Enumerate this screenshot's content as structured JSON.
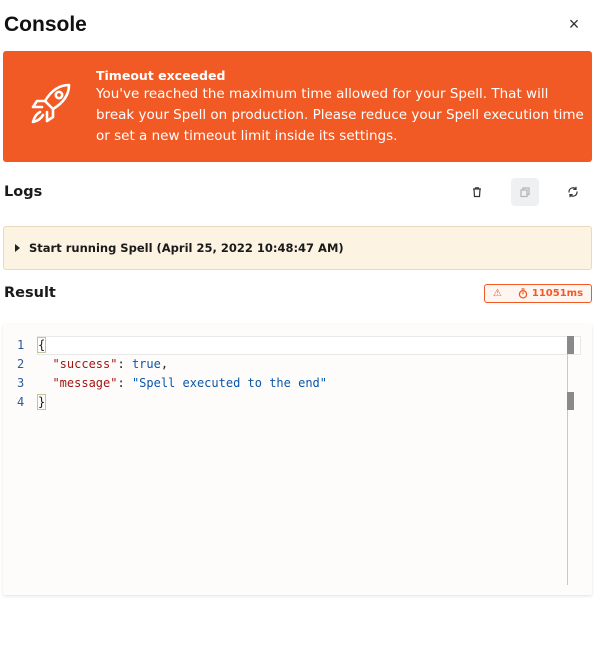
{
  "header": {
    "title": "Console",
    "close_icon": "×"
  },
  "alert": {
    "icon": "rocket-icon",
    "title": "Timeout exceeded",
    "message": "You've reached the maximum time allowed for your Spell. That will break your Spell on production. Please reduce your Spell execution time or set a new timeout limit inside its settings.",
    "background": "#f15a24"
  },
  "logs": {
    "title": "Logs",
    "tools": [
      "trash-icon",
      "copy-icon",
      "refresh-icon"
    ],
    "entries": [
      {
        "text": "Start running Spell (April 25, 2022 10:48:47 AM)"
      }
    ]
  },
  "result": {
    "title": "Result",
    "badge": {
      "warning_icon": "⚠",
      "time": "11051ms"
    }
  },
  "editor": {
    "lines": [
      {
        "num": "1"
      },
      {
        "num": "2",
        "key": "\"success\"",
        "value": "true"
      },
      {
        "num": "3",
        "key": "\"message\"",
        "value": "\"Spell executed to the end\""
      },
      {
        "num": "4"
      }
    ]
  }
}
